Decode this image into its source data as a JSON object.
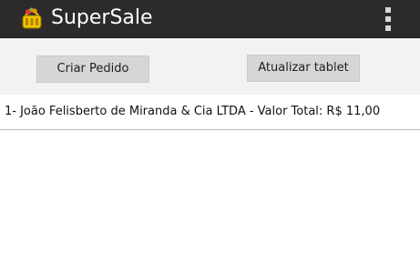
{
  "app": {
    "title": "SuperSale",
    "icon": "shopping-basket-icon",
    "menu_icon": "overflow-menu-icon"
  },
  "actions": {
    "create_order_label": "Criar Pedido",
    "update_tablet_label": "Atualizar tablet"
  },
  "orders": [
    {
      "text": "1- João Felisberto de Miranda & Cia LTDA - Valor Total: R$ 11,00"
    }
  ],
  "colors": {
    "action_bar": "#2b2b2b",
    "toolbar_background": "#f2f2f2",
    "button_background": "#d6d6d6",
    "text": "#111111"
  }
}
